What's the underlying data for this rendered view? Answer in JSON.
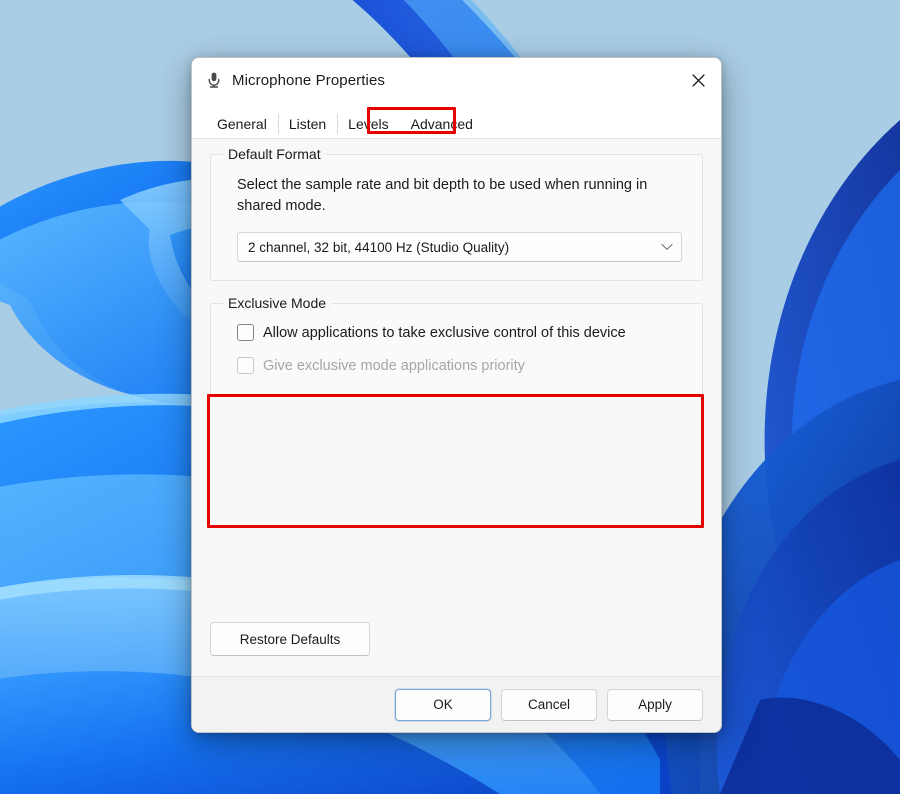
{
  "desktop": {
    "wallpaper_name": "windows-11-bloom-wallpaper",
    "background_color": "#a9cde5",
    "accent_blue": "#0f6cf0",
    "deep_blue": "#0b2f9e"
  },
  "dialog": {
    "title": "Microphone Properties",
    "icon": "microphone-icon",
    "close_label": "✕",
    "tabs": [
      {
        "label": "General",
        "selected": false
      },
      {
        "label": "Listen",
        "selected": false
      },
      {
        "label": "Levels",
        "selected": false
      },
      {
        "label": "Advanced",
        "selected": true
      }
    ],
    "annotations": {
      "color": "#e60000",
      "tab_target": "Advanced",
      "section_target": "Exclusive Mode"
    },
    "default_format": {
      "group_title": "Default Format",
      "description": "Select the sample rate and bit depth to be used when running in shared mode.",
      "selected_value": "2 channel, 32 bit, 44100 Hz (Studio Quality)",
      "chevron": "chevron-down-icon"
    },
    "exclusive_mode": {
      "group_title": "Exclusive Mode",
      "checkboxes": [
        {
          "label": "Allow applications to take exclusive control of this device",
          "checked": false,
          "disabled": false
        },
        {
          "label": "Give exclusive mode applications priority",
          "checked": false,
          "disabled": true
        }
      ]
    },
    "restore_defaults_label": "Restore Defaults",
    "footer_buttons": [
      {
        "label": "OK",
        "primary": true
      },
      {
        "label": "Cancel",
        "primary": false
      },
      {
        "label": "Apply",
        "primary": false
      }
    ]
  }
}
